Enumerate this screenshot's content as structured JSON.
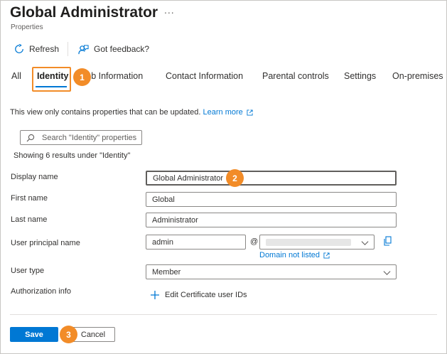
{
  "header": {
    "title": "Global Administrator",
    "more_label": "...",
    "subtitle": "Properties"
  },
  "toolbar": {
    "refresh_label": "Refresh",
    "feedback_label": "Got feedback?"
  },
  "tabs": [
    {
      "label": "All"
    },
    {
      "label": "Identity",
      "active": true
    },
    {
      "label": "Job Information"
    },
    {
      "label": "Contact Information"
    },
    {
      "label": "Parental controls"
    },
    {
      "label": "Settings"
    },
    {
      "label": "On-premises"
    }
  ],
  "callouts": [
    "1",
    "2",
    "3"
  ],
  "info": {
    "text": "This view only contains properties that can be updated.",
    "link": "Learn more"
  },
  "search": {
    "placeholder": "Search \"Identity\" properties"
  },
  "results_text": "Showing 6 results under \"Identity\"",
  "form": {
    "display_name": {
      "label": "Display name",
      "value": "Global Administrator"
    },
    "first_name": {
      "label": "First name",
      "value": "Global"
    },
    "last_name": {
      "label": "Last name",
      "value": "Administrator"
    },
    "upn": {
      "label": "User principal name",
      "value": "admin",
      "at": "@",
      "domain_not_listed": "Domain not listed"
    },
    "user_type": {
      "label": "User type",
      "value": "Member"
    },
    "authorization": {
      "label": "Authorization info",
      "add_label": "Edit Certificate user IDs"
    }
  },
  "footer": {
    "save_label": "Save",
    "cancel_label": "Cancel"
  },
  "colors": {
    "accent": "#0078d4",
    "callout": "#f28c28"
  }
}
